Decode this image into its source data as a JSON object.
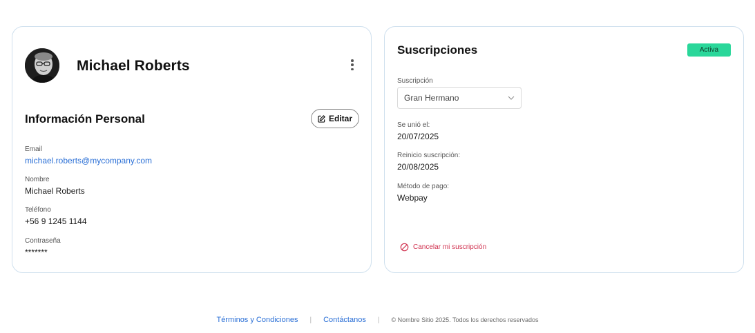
{
  "profile": {
    "name": "Michael Roberts"
  },
  "personal_info": {
    "title": "Información Personal",
    "edit_label": "Editar",
    "fields": [
      {
        "label": "Email",
        "value": "michael.roberts@mycompany.com"
      },
      {
        "label": "Nombre",
        "value": "Michael Roberts"
      },
      {
        "label": "Teléfono",
        "value": "+56 9 1245 1144"
      },
      {
        "label": "Contraseña",
        "value": "*******"
      }
    ]
  },
  "subscriptions": {
    "title": "Suscripciones",
    "status_badge": "Activa",
    "select_label": "Suscripción",
    "select_value": "Gran Hermano",
    "fields": [
      {
        "label": "Se unió el:",
        "value": "20/07/2025"
      },
      {
        "label": "Reinicio suscripción:",
        "value": "20/08/2025"
      },
      {
        "label": "Método de pago:",
        "value": "Webpay"
      }
    ],
    "cancel_label": "Cancelar mi suscripción"
  },
  "footer": {
    "terms": "Términos y Condiciones",
    "separator": "|",
    "contact": "Contáctanos",
    "copyright": "© Nombre Sitio 2025. Todos los derechos reservados"
  },
  "colors": {
    "link": "#2a6fd6",
    "badge_bg": "#2ad79a",
    "danger": "#d0314f",
    "card_border": "#cfe0ee"
  },
  "icons": {
    "more": "vertical-ellipsis-icon",
    "edit": "edit-icon",
    "chevron": "chevron-down-icon",
    "cancel": "cancel-circle-icon"
  }
}
